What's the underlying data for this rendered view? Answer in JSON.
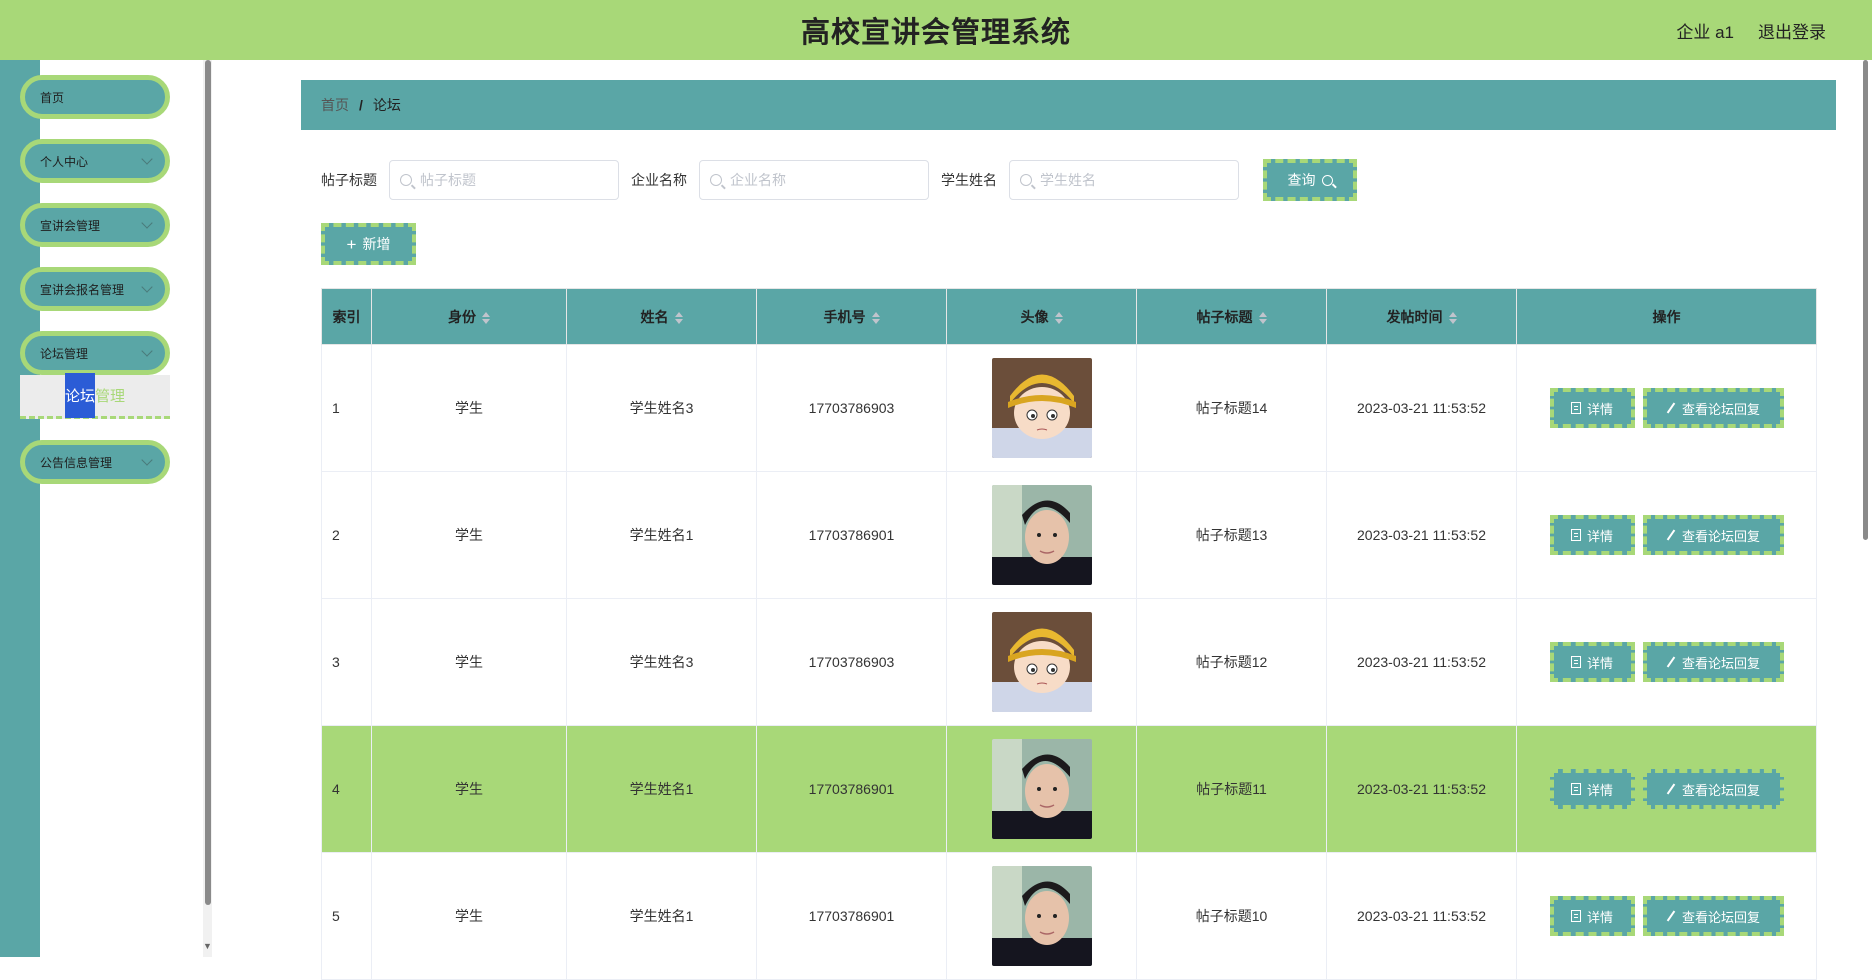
{
  "header": {
    "title": "高校宣讲会管理系统",
    "user": "企业 a1",
    "logout": "退出登录"
  },
  "sidebar": {
    "items": [
      {
        "label": "首页",
        "has_children": false
      },
      {
        "label": "个人中心",
        "has_children": true
      },
      {
        "label": "宣讲会管理",
        "has_children": true
      },
      {
        "label": "宣讲会报名管理",
        "has_children": true
      },
      {
        "label": "论坛管理",
        "has_children": true
      },
      {
        "label": "公告信息管理",
        "has_children": true
      }
    ],
    "submenu": {
      "selected_part": "论坛",
      "rest_part": "管理"
    }
  },
  "breadcrumb": {
    "home": "首页",
    "sep": "/",
    "current": "论坛"
  },
  "search": {
    "title_label": "帖子标题",
    "title_placeholder": "帖子标题",
    "company_label": "企业名称",
    "company_placeholder": "企业名称",
    "student_label": "学生姓名",
    "student_placeholder": "学生姓名",
    "query_button": "查询"
  },
  "add_button": "新增",
  "table": {
    "columns": [
      "索引",
      "身份",
      "姓名",
      "手机号",
      "头像",
      "帖子标题",
      "发帖时间",
      "操作"
    ],
    "rows": [
      {
        "index": "1",
        "role": "学生",
        "name": "学生姓名3",
        "phone": "17703786903",
        "avatar": "cartoon",
        "title": "帖子标题14",
        "time": "2023-03-21 11:53:52"
      },
      {
        "index": "2",
        "role": "学生",
        "name": "学生姓名1",
        "phone": "17703786901",
        "avatar": "photo",
        "title": "帖子标题13",
        "time": "2023-03-21 11:53:52"
      },
      {
        "index": "3",
        "role": "学生",
        "name": "学生姓名3",
        "phone": "17703786903",
        "avatar": "cartoon",
        "title": "帖子标题12",
        "time": "2023-03-21 11:53:52"
      },
      {
        "index": "4",
        "role": "学生",
        "name": "学生姓名1",
        "phone": "17703786901",
        "avatar": "photo",
        "title": "帖子标题11",
        "time": "2023-03-21 11:53:52"
      },
      {
        "index": "5",
        "role": "学生",
        "name": "学生姓名1",
        "phone": "17703786901",
        "avatar": "photo",
        "title": "帖子标题10",
        "time": "2023-03-21 11:53:52"
      }
    ],
    "actions": {
      "detail": "详情",
      "reply": "查看论坛回复"
    }
  },
  "colors": {
    "primary": "#5aa6a6",
    "accent": "#a8d878"
  },
  "icons": [
    "chevron-down-icon",
    "search-icon",
    "plus-icon",
    "document-icon",
    "edit-icon",
    "sort-icon"
  ]
}
